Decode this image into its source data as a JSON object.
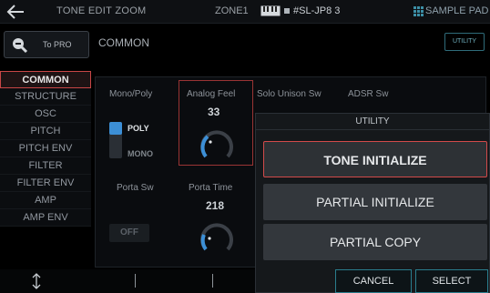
{
  "header": {
    "title": "TONE EDIT ZOOM",
    "zone": "ZONE1",
    "tone_name": "#SL-JP8 3",
    "sample_pad_label": "SAMPLE PAD"
  },
  "to_pro_label": "To PRO",
  "nav": {
    "items": [
      {
        "label": "COMMON",
        "active": true
      },
      {
        "label": "STRUCTURE"
      },
      {
        "label": "OSC"
      },
      {
        "label": "PITCH"
      },
      {
        "label": "PITCH ENV"
      },
      {
        "label": "FILTER"
      },
      {
        "label": "FILTER ENV"
      },
      {
        "label": "AMP"
      },
      {
        "label": "AMP ENV"
      }
    ]
  },
  "main": {
    "section_title": "COMMON",
    "utility_button": "UTILITY",
    "params": {
      "mono_poly": {
        "label": "Mono/Poly",
        "options": [
          "POLY",
          "MONO"
        ],
        "value": "POLY"
      },
      "analog_feel": {
        "label": "Analog Feel",
        "value": "33"
      },
      "solo_unison_sw": {
        "label": "Solo Unison Sw"
      },
      "adsr_sw": {
        "label": "ADSR Sw"
      },
      "porta_sw": {
        "label": "Porta Sw",
        "value": "OFF"
      },
      "porta_time": {
        "label": "Porta Time",
        "value": "218"
      }
    }
  },
  "utility_dialog": {
    "title": "UTILITY",
    "options": [
      "TONE INITIALIZE",
      "PARTIAL INITIALIZE",
      "PARTIAL COPY"
    ],
    "cancel_label": "CANCEL",
    "select_label": "SELECT"
  },
  "colors": {
    "accent_red": "#d24a4a",
    "accent_blue": "#3c8fd6",
    "accent_teal": "#2a7d8d"
  }
}
